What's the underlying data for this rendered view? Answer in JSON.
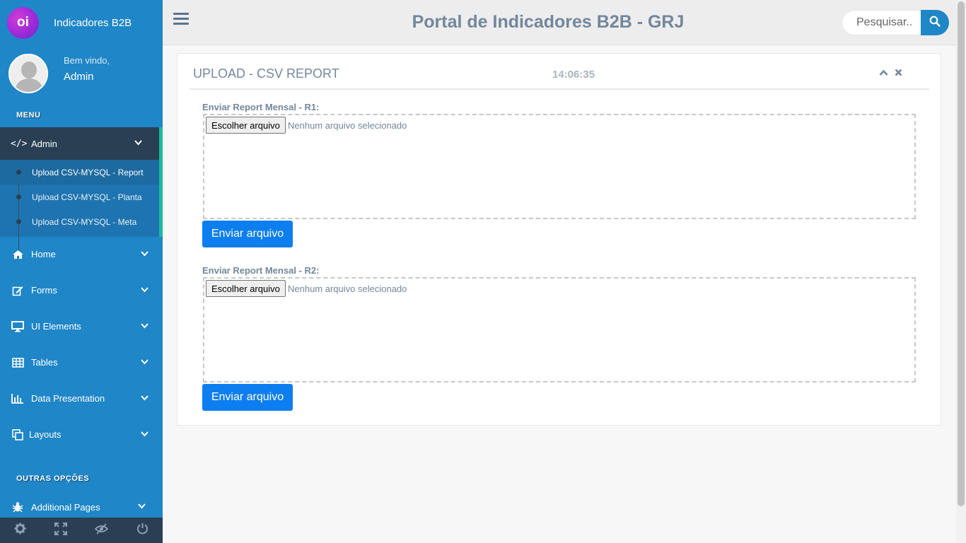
{
  "brand": {
    "logo_text": "oi",
    "name": "Indicadores B2B"
  },
  "profile": {
    "greeting": "Bem vindo,",
    "user": "Admin"
  },
  "sidebar": {
    "menu_title": "MENU",
    "admin": {
      "label": "Admin",
      "icon": "code-icon",
      "subitems": [
        {
          "label": "Upload CSV-MYSQL - Report",
          "active": true
        },
        {
          "label": "Upload CSV-MYSQL - Planta",
          "active": false
        },
        {
          "label": "Upload CSV-MYSQL - Meta",
          "active": false
        }
      ]
    },
    "items": [
      {
        "label": "Home",
        "icon": "home-icon"
      },
      {
        "label": "Forms",
        "icon": "edit-icon"
      },
      {
        "label": "UI Elements",
        "icon": "desktop-icon"
      },
      {
        "label": "Tables",
        "icon": "table-icon"
      },
      {
        "label": "Data Presentation",
        "icon": "bar-chart-icon"
      },
      {
        "label": "Layouts",
        "icon": "clone-icon"
      }
    ],
    "other_title": "OUTRAS OPÇÕES",
    "additional": {
      "label": "Additional Pages",
      "icon": "bug-icon"
    },
    "footer_icons": [
      "gear-icon",
      "fullscreen-icon",
      "eye-slash-icon",
      "power-icon"
    ]
  },
  "topbar": {
    "title": "Portal de Indicadores B2B - GRJ",
    "search_placeholder": "Pesquisar.."
  },
  "panel": {
    "title": "UPLOAD - CSV REPORT",
    "time": "14:06:35",
    "uploads": [
      {
        "label": "Enviar Report Mensal - R1:",
        "choose": "Escolher arquivo",
        "status": "Nenhum arquivo selecionado",
        "submit": "Enviar arquivo"
      },
      {
        "label": "Enviar Report Mensal - R2:",
        "choose": "Escolher arquivo",
        "status": "Nenhum arquivo selecionado",
        "submit": "Enviar arquivo"
      }
    ]
  },
  "colors": {
    "sidebar": "#1f86c8",
    "sidebar_dark": "#2a3f54",
    "accent": "#1abb9c",
    "button": "#0d7ef0",
    "text_muted": "#73879c"
  }
}
